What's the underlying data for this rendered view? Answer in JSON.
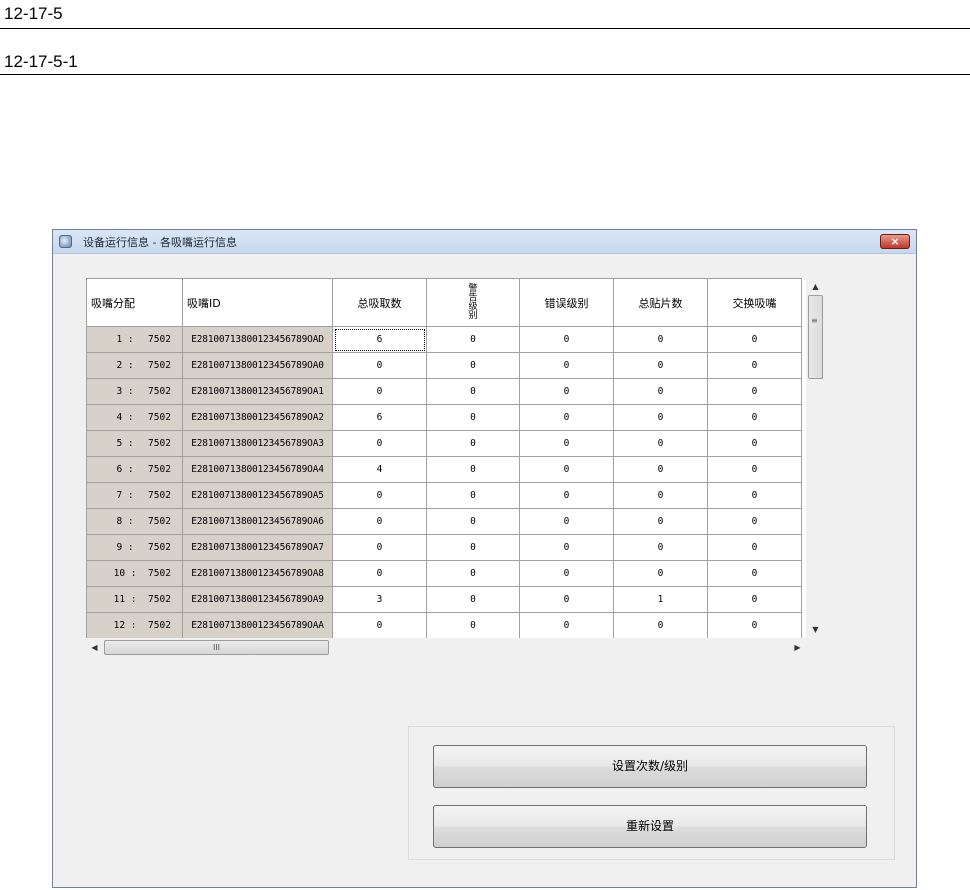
{
  "doc": {
    "section": "12-17-5",
    "subsection": "12-17-5-1"
  },
  "window": {
    "title": "设备运行信息 - 各吸嘴运行信息",
    "icon": "app-info-icon",
    "close": "×"
  },
  "grid": {
    "columns": [
      "吸嘴分配",
      "吸嘴ID",
      "总吸取数",
      "警告级别",
      "错误级别",
      "总贴片数",
      "交换吸嘴"
    ],
    "rows": [
      {
        "num": "1 :",
        "assign": "7502",
        "id": "E28100713800123456789OAD",
        "total_pick": "6",
        "warn": "0",
        "error": "0",
        "total_place": "0",
        "swap": "0"
      },
      {
        "num": "2 :",
        "assign": "7502",
        "id": "E28100713800123456789OA0",
        "total_pick": "0",
        "warn": "0",
        "error": "0",
        "total_place": "0",
        "swap": "0"
      },
      {
        "num": "3 :",
        "assign": "7502",
        "id": "E28100713800123456789OA1",
        "total_pick": "0",
        "warn": "0",
        "error": "0",
        "total_place": "0",
        "swap": "0"
      },
      {
        "num": "4 :",
        "assign": "7502",
        "id": "E28100713800123456789OA2",
        "total_pick": "6",
        "warn": "0",
        "error": "0",
        "total_place": "0",
        "swap": "0"
      },
      {
        "num": "5 :",
        "assign": "7502",
        "id": "E28100713800123456789OA3",
        "total_pick": "0",
        "warn": "0",
        "error": "0",
        "total_place": "0",
        "swap": "0"
      },
      {
        "num": "6 :",
        "assign": "7502",
        "id": "E28100713800123456789OA4",
        "total_pick": "4",
        "warn": "0",
        "error": "0",
        "total_place": "0",
        "swap": "0"
      },
      {
        "num": "7 :",
        "assign": "7502",
        "id": "E28100713800123456789OA5",
        "total_pick": "0",
        "warn": "0",
        "error": "0",
        "total_place": "0",
        "swap": "0"
      },
      {
        "num": "8 :",
        "assign": "7502",
        "id": "E28100713800123456789OA6",
        "total_pick": "0",
        "warn": "0",
        "error": "0",
        "total_place": "0",
        "swap": "0"
      },
      {
        "num": "9 :",
        "assign": "7502",
        "id": "E28100713800123456789OA7",
        "total_pick": "0",
        "warn": "0",
        "error": "0",
        "total_place": "0",
        "swap": "0"
      },
      {
        "num": "10 :",
        "assign": "7502",
        "id": "E28100713800123456789OA8",
        "total_pick": "0",
        "warn": "0",
        "error": "0",
        "total_place": "0",
        "swap": "0"
      },
      {
        "num": "11 :",
        "assign": "7502",
        "id": "E28100713800123456789OA9",
        "total_pick": "3",
        "warn": "0",
        "error": "0",
        "total_place": "1",
        "swap": "0"
      },
      {
        "num": "12 :",
        "assign": "7502",
        "id": "E28100713800123456789OAA",
        "total_pick": "0",
        "warn": "0",
        "error": "0",
        "total_place": "0",
        "swap": "0"
      }
    ]
  },
  "scrollbars": {
    "up": "▲",
    "down": "▼",
    "left": "◀",
    "right": "▶",
    "v_grip": "≡",
    "h_grip": "III"
  },
  "buttons": {
    "set_count_level": "设置次数/级别",
    "reset": "重新设置"
  }
}
